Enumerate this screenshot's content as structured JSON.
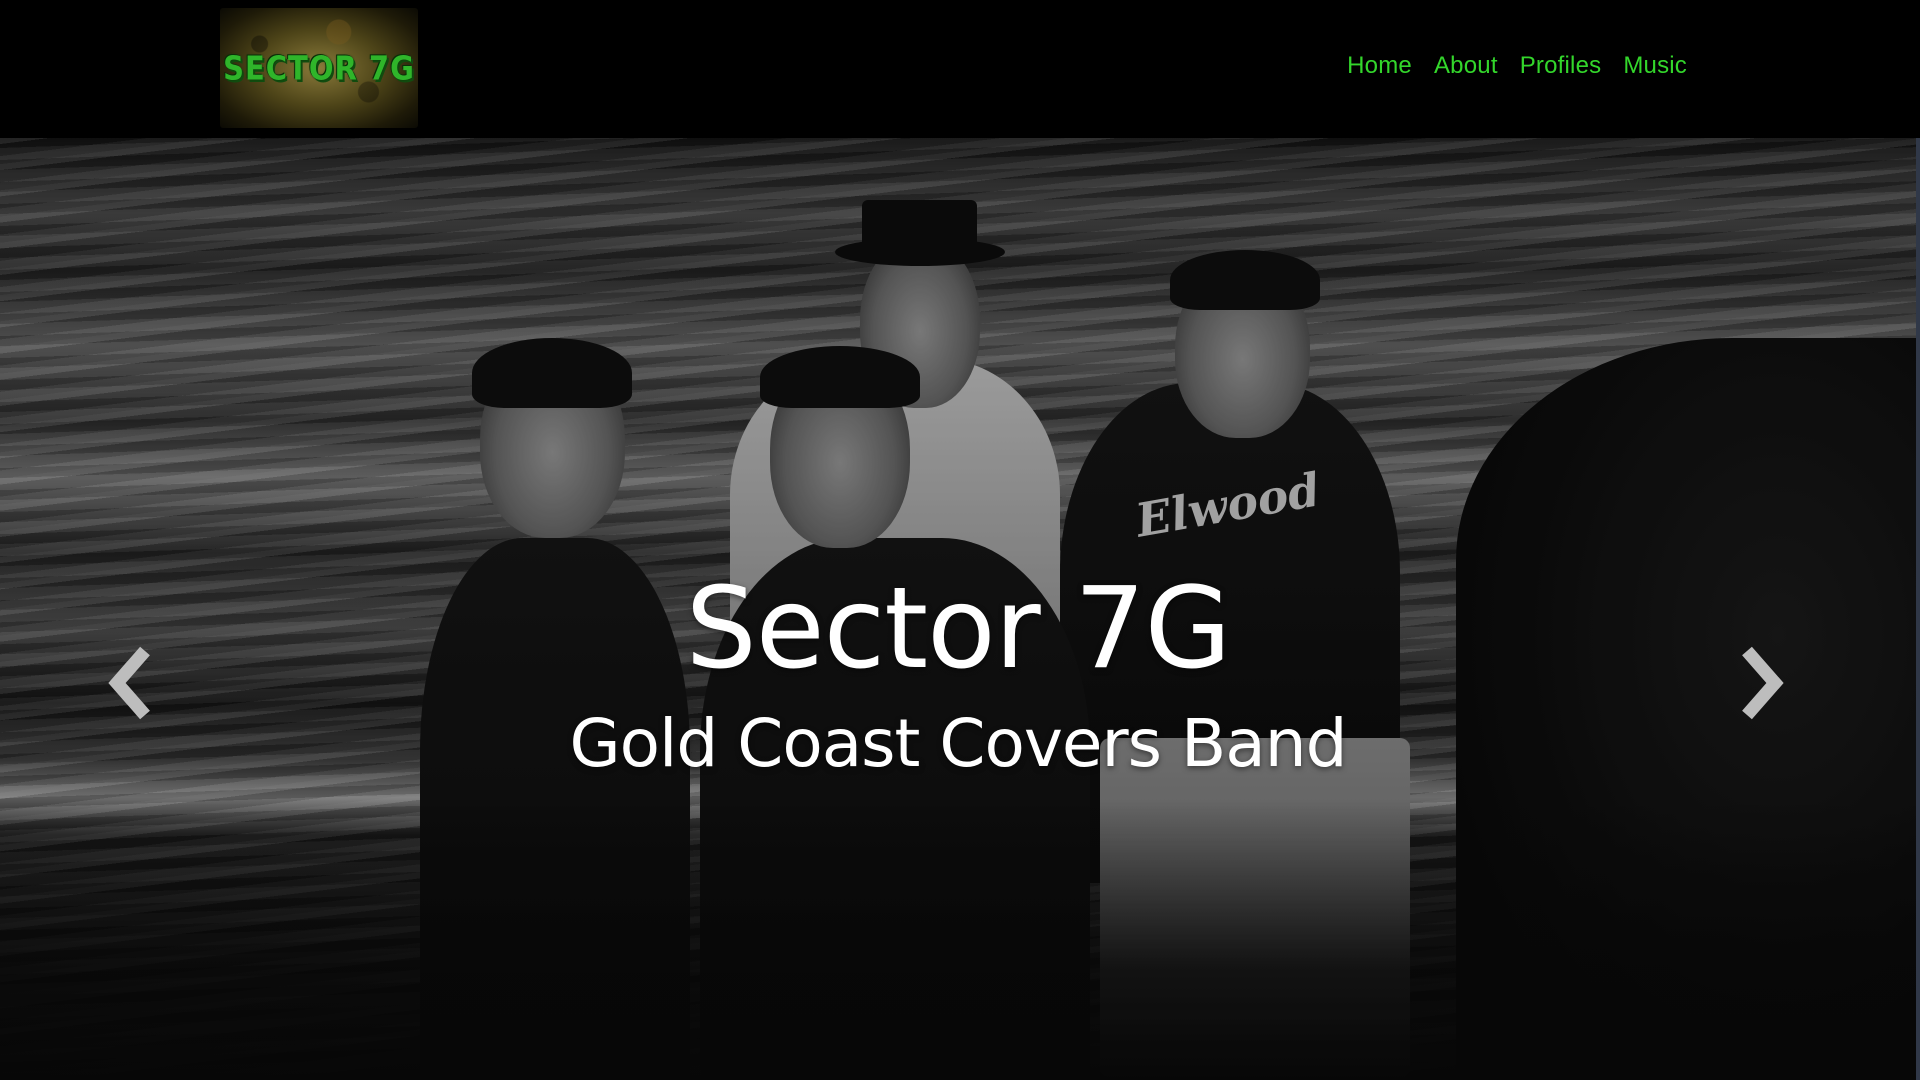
{
  "site": {
    "logo_text": "SECTOR 7G"
  },
  "nav": {
    "items": [
      {
        "label": "Home"
      },
      {
        "label": "About"
      },
      {
        "label": "Profiles"
      },
      {
        "label": "Music"
      }
    ],
    "link_color": "#33d62b"
  },
  "hero": {
    "title": "Sector 7G",
    "subtitle": "Gold Coast Covers Band",
    "shirt_text": "Elwood",
    "prev_icon": "chevron-left-icon",
    "next_icon": "chevron-right-icon"
  }
}
